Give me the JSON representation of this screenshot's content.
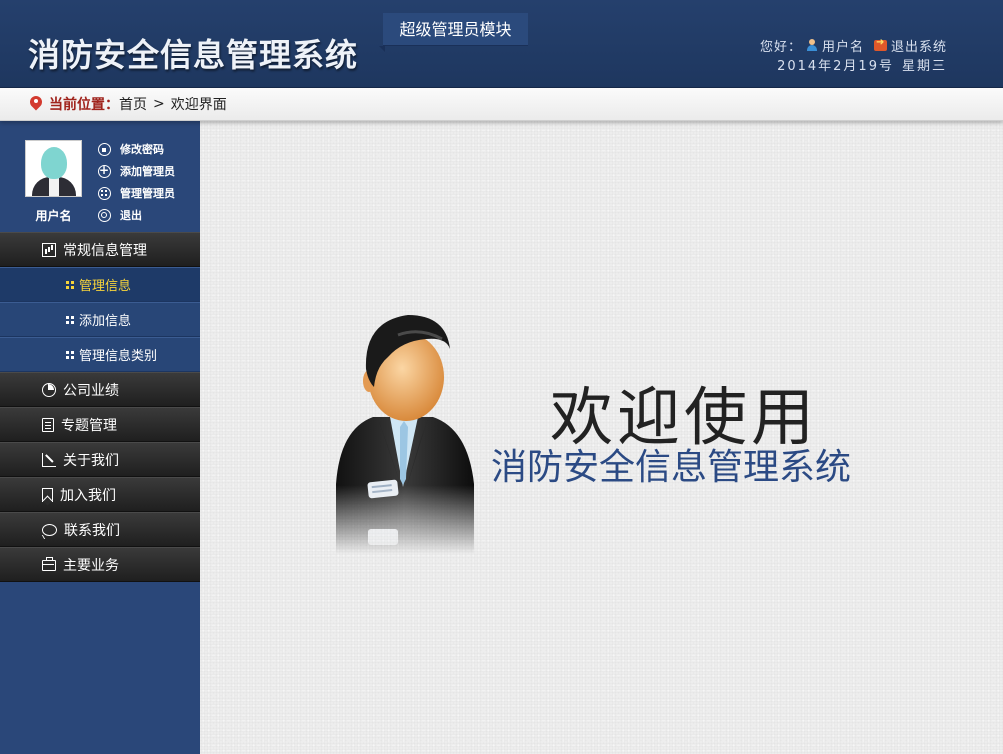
{
  "header": {
    "title": "消防安全信息管理系统",
    "module_tag": "超级管理员模块",
    "greeting": "您好：",
    "username": "用户名",
    "logout": "退出系统",
    "date": "2014年2月19号",
    "weekday": "星期三"
  },
  "breadcrumb": {
    "label": "当前位置：",
    "home": "首页",
    "separator": ">",
    "current": "欢迎界面"
  },
  "sidebar": {
    "profile_name": "用户名",
    "quick_links": [
      {
        "label": "修改密码",
        "icon": "lock-icon"
      },
      {
        "label": "添加管理员",
        "icon": "plus-icon"
      },
      {
        "label": "管理管理员",
        "icon": "grid-icon"
      },
      {
        "label": "退出",
        "icon": "power-icon"
      }
    ],
    "groups": [
      {
        "label": "常规信息管理",
        "icon": "bar-chart-icon"
      },
      {
        "label": "公司业绩",
        "icon": "pie-chart-icon"
      },
      {
        "label": "专题管理",
        "icon": "document-icon"
      },
      {
        "label": "关于我们",
        "icon": "edit-icon"
      },
      {
        "label": "加入我们",
        "icon": "bookmark-icon"
      },
      {
        "label": "联系我们",
        "icon": "chat-icon"
      },
      {
        "label": "主要业务",
        "icon": "briefcase-icon"
      }
    ],
    "sub_items": [
      {
        "label": "管理信息",
        "active": true
      },
      {
        "label": "添加信息",
        "active": false
      },
      {
        "label": "管理信息类别",
        "active": false
      }
    ]
  },
  "main": {
    "welcome_title": "欢迎使用",
    "welcome_system": "消防安全信息管理系统"
  },
  "colors": {
    "header_bg": "#23406c",
    "sidebar_bg": "#2a4779",
    "active_sub_text": "#f7d43b",
    "breadcrumb_label": "#a0231c",
    "welcome_system_text": "#2b4a84"
  }
}
